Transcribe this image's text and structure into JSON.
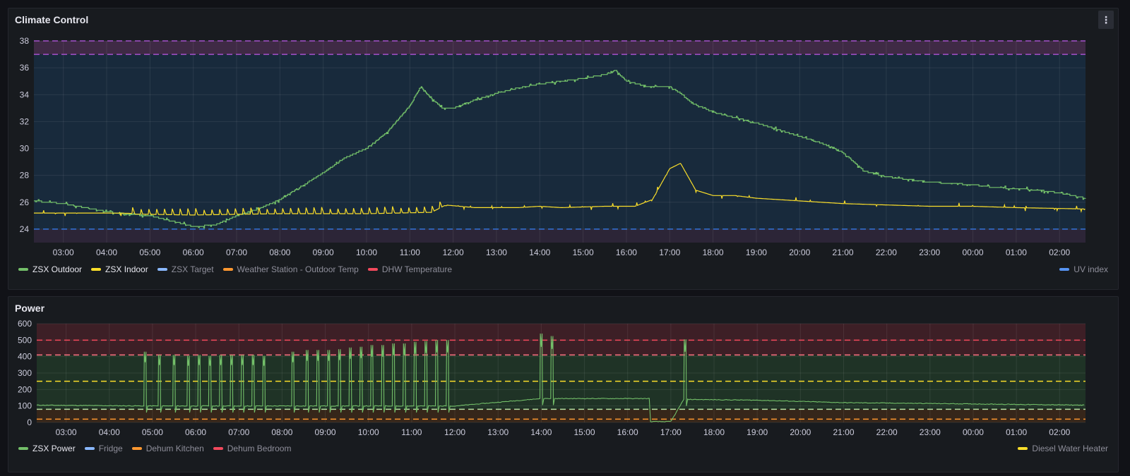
{
  "panels": {
    "climate": {
      "title": "Climate Control",
      "menu_label": "⋮"
    },
    "power": {
      "title": "Power"
    }
  },
  "chart_data": [
    {
      "type": "line",
      "title": "Climate Control",
      "xlabel": "",
      "ylabel": "",
      "x_ticks": [
        "03:00",
        "04:00",
        "05:00",
        "06:00",
        "07:00",
        "08:00",
        "09:00",
        "10:00",
        "11:00",
        "12:00",
        "13:00",
        "14:00",
        "15:00",
        "16:00",
        "17:00",
        "18:00",
        "19:00",
        "20:00",
        "21:00",
        "22:00",
        "23:00",
        "00:00",
        "01:00",
        "02:00"
      ],
      "x_range_hours": [
        2.32,
        26.6
      ],
      "y_ticks": [
        24,
        26,
        28,
        30,
        32,
        34,
        36,
        38
      ],
      "ylim": [
        23,
        38
      ],
      "grid": true,
      "legend_placement": "bottom",
      "thresholds": [
        {
          "value": 38,
          "color": "#a352cc"
        },
        {
          "value": 37,
          "color": "#a352cc"
        },
        {
          "value": 24,
          "color": "#3274d9"
        }
      ],
      "bands": [
        {
          "from": 37,
          "to": 38,
          "color": "#3f2a45"
        },
        {
          "from": 24,
          "to": 37,
          "color": "#182a3c"
        },
        {
          "from": 23,
          "to": 24,
          "color": "#2c2537"
        }
      ],
      "series": [
        {
          "name": "ZSX Outdoor",
          "color": "#73bf69",
          "x": [
            2.32,
            3.0,
            3.5,
            4.0,
            4.5,
            5.0,
            5.5,
            6.0,
            6.5,
            7.0,
            7.5,
            8.0,
            8.5,
            9.0,
            9.5,
            10.0,
            10.5,
            11.0,
            11.25,
            11.5,
            11.75,
            12.0,
            12.5,
            13.0,
            13.5,
            14.0,
            14.5,
            15.0,
            15.5,
            15.75,
            16.0,
            16.5,
            17.0,
            17.25,
            17.5,
            18.0,
            18.5,
            19.0,
            19.5,
            20.0,
            20.5,
            21.0,
            21.5,
            22.0,
            22.5,
            23.0,
            23.5,
            24.0,
            24.5,
            25.0,
            25.5,
            26.0,
            26.6
          ],
          "y": [
            26.1,
            25.9,
            25.6,
            25.3,
            25.1,
            25.0,
            24.6,
            24.2,
            24.3,
            25.0,
            25.5,
            26.2,
            27.2,
            28.2,
            29.3,
            30.0,
            31.3,
            33.2,
            34.6,
            33.7,
            33.0,
            33.0,
            33.6,
            34.1,
            34.5,
            34.8,
            35.0,
            35.2,
            35.5,
            35.8,
            35.0,
            34.6,
            34.6,
            34.1,
            33.4,
            32.7,
            32.3,
            31.9,
            31.4,
            30.9,
            30.4,
            29.7,
            28.3,
            27.9,
            27.7,
            27.5,
            27.4,
            27.3,
            27.1,
            27.0,
            26.9,
            26.7,
            26.3
          ]
        },
        {
          "name": "ZSX Indoor",
          "color": "#fade2a",
          "x": [
            2.32,
            4.0,
            6.0,
            8.0,
            10.0,
            11.5,
            11.8,
            12.5,
            13.5,
            14.0,
            14.5,
            15.5,
            16.2,
            16.6,
            17.0,
            17.25,
            17.6,
            18.0,
            18.5,
            19.0,
            20.0,
            21.0,
            22.0,
            23.0,
            24.0,
            25.0,
            26.6
          ],
          "y": [
            25.2,
            25.2,
            25.1,
            25.2,
            25.2,
            25.3,
            25.8,
            25.6,
            25.6,
            25.7,
            25.6,
            25.7,
            25.7,
            26.2,
            28.5,
            28.9,
            26.9,
            26.5,
            26.5,
            26.3,
            26.1,
            25.9,
            25.8,
            25.7,
            25.7,
            25.6,
            25.5
          ]
        },
        {
          "name": "ZSX Target",
          "color": "#8ab8ff",
          "x": [],
          "y": []
        },
        {
          "name": "Weather Station - Outdoor Temp",
          "color": "#ff9830",
          "x": [],
          "y": []
        },
        {
          "name": "DHW Temperature",
          "color": "#f2495c",
          "x": [],
          "y": []
        },
        {
          "name": "UV index",
          "color": "#5794f2",
          "x": [],
          "y": []
        }
      ]
    },
    {
      "type": "line",
      "title": "Power",
      "xlabel": "",
      "ylabel": "",
      "x_ticks": [
        "03:00",
        "04:00",
        "05:00",
        "06:00",
        "07:00",
        "08:00",
        "09:00",
        "10:00",
        "11:00",
        "12:00",
        "13:00",
        "14:00",
        "15:00",
        "16:00",
        "17:00",
        "18:00",
        "19:00",
        "20:00",
        "21:00",
        "22:00",
        "23:00",
        "00:00",
        "01:00",
        "02:00"
      ],
      "x_range_hours": [
        2.32,
        26.6
      ],
      "y_ticks": [
        0,
        100,
        200,
        300,
        400,
        500,
        600
      ],
      "ylim": [
        0,
        600
      ],
      "grid": true,
      "legend_placement": "bottom",
      "thresholds": [
        {
          "value": 500,
          "color": "#f2495c"
        },
        {
          "value": 410,
          "color": "#ff7383"
        },
        {
          "value": 250,
          "color": "#fade2a"
        },
        {
          "value": 80,
          "color": "#b8e0a3"
        },
        {
          "value": 20,
          "color": "#ff9830"
        }
      ],
      "bands": [
        {
          "from": 410,
          "to": 600,
          "color": "#3d1f26"
        },
        {
          "from": 80,
          "to": 410,
          "color": "#1f3326"
        },
        {
          "from": 0,
          "to": 80,
          "color": "#36261a"
        }
      ],
      "series": [
        {
          "name": "ZSX Power",
          "color": "#73bf69",
          "baseline": [
            {
              "x": 2.32,
              "y": 105
            },
            {
              "x": 4.8,
              "y": 100
            },
            {
              "x": 12.0,
              "y": 100
            },
            {
              "x": 14.0,
              "y": 145
            },
            {
              "x": 16.5,
              "y": 145
            },
            {
              "x": 16.5,
              "y": 5
            },
            {
              "x": 17.0,
              "y": 5
            },
            {
              "x": 17.3,
              "y": 140
            },
            {
              "x": 19.0,
              "y": 135
            },
            {
              "x": 21.0,
              "y": 120
            },
            {
              "x": 23.0,
              "y": 115
            },
            {
              "x": 26.6,
              "y": 105
            }
          ],
          "spikes": [
            {
              "x": 4.83,
              "y": 430
            },
            {
              "x": 5.16,
              "y": 410
            },
            {
              "x": 5.5,
              "y": 410
            },
            {
              "x": 5.83,
              "y": 405
            },
            {
              "x": 6.08,
              "y": 410
            },
            {
              "x": 6.33,
              "y": 405
            },
            {
              "x": 6.58,
              "y": 410
            },
            {
              "x": 6.83,
              "y": 410
            },
            {
              "x": 7.08,
              "y": 410
            },
            {
              "x": 7.33,
              "y": 410
            },
            {
              "x": 7.58,
              "y": 405
            },
            {
              "x": 8.25,
              "y": 430
            },
            {
              "x": 8.58,
              "y": 440
            },
            {
              "x": 8.83,
              "y": 440
            },
            {
              "x": 9.08,
              "y": 440
            },
            {
              "x": 9.33,
              "y": 445
            },
            {
              "x": 9.58,
              "y": 455
            },
            {
              "x": 9.83,
              "y": 460
            },
            {
              "x": 10.08,
              "y": 470
            },
            {
              "x": 10.33,
              "y": 470
            },
            {
              "x": 10.58,
              "y": 480
            },
            {
              "x": 10.83,
              "y": 480
            },
            {
              "x": 11.08,
              "y": 490
            },
            {
              "x": 11.33,
              "y": 495
            },
            {
              "x": 11.58,
              "y": 500
            },
            {
              "x": 11.83,
              "y": 500
            },
            {
              "x": 14.0,
              "y": 540
            },
            {
              "x": 14.25,
              "y": 525
            },
            {
              "x": 17.33,
              "y": 505
            }
          ]
        },
        {
          "name": "Fridge",
          "color": "#8ab8ff",
          "x": [],
          "y": []
        },
        {
          "name": "Dehum Kitchen",
          "color": "#ff9830",
          "x": [],
          "y": []
        },
        {
          "name": "Dehum Bedroom",
          "color": "#f2495c",
          "x": [],
          "y": []
        },
        {
          "name": "Diesel Water Heater",
          "color": "#fade2a",
          "x": [],
          "y": []
        }
      ]
    }
  ]
}
